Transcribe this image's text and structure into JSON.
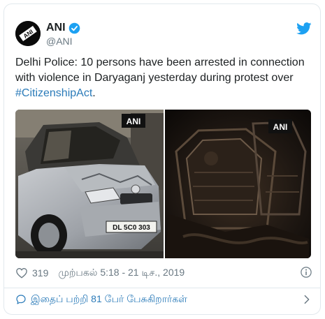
{
  "tweet": {
    "author": {
      "display_name": "ANI",
      "handle": "@ANI",
      "avatar_text": "ANI",
      "verified": true
    },
    "text_before": "Delhi Police: 10 persons have been arrested in connection with violence in Daryaganj yesterday during protest over ",
    "hashtag": "#CitizenshipAct",
    "text_after": ".",
    "media": {
      "left_watermark": "ANI",
      "right_watermark": "ANI",
      "plate_text": "DL 5C0 303"
    },
    "likes": "319",
    "timestamp": "முற்பகல் 5:18 - 21 டிச., 2019",
    "footer_label": "இதைப் பற்றி 81 பேர் பேசுகிறார்கள்"
  },
  "colors": {
    "link": "#2b7bb9",
    "muted": "#697882",
    "twitter_blue": "#1da1f2",
    "border": "#e1e8ed"
  },
  "icons": {
    "brand": "twitter-bird-icon",
    "verified": "verified-badge-icon",
    "like": "heart-icon",
    "info": "info-icon",
    "reply": "reply-bubble-icon",
    "chevron": "chevron-right-icon"
  }
}
